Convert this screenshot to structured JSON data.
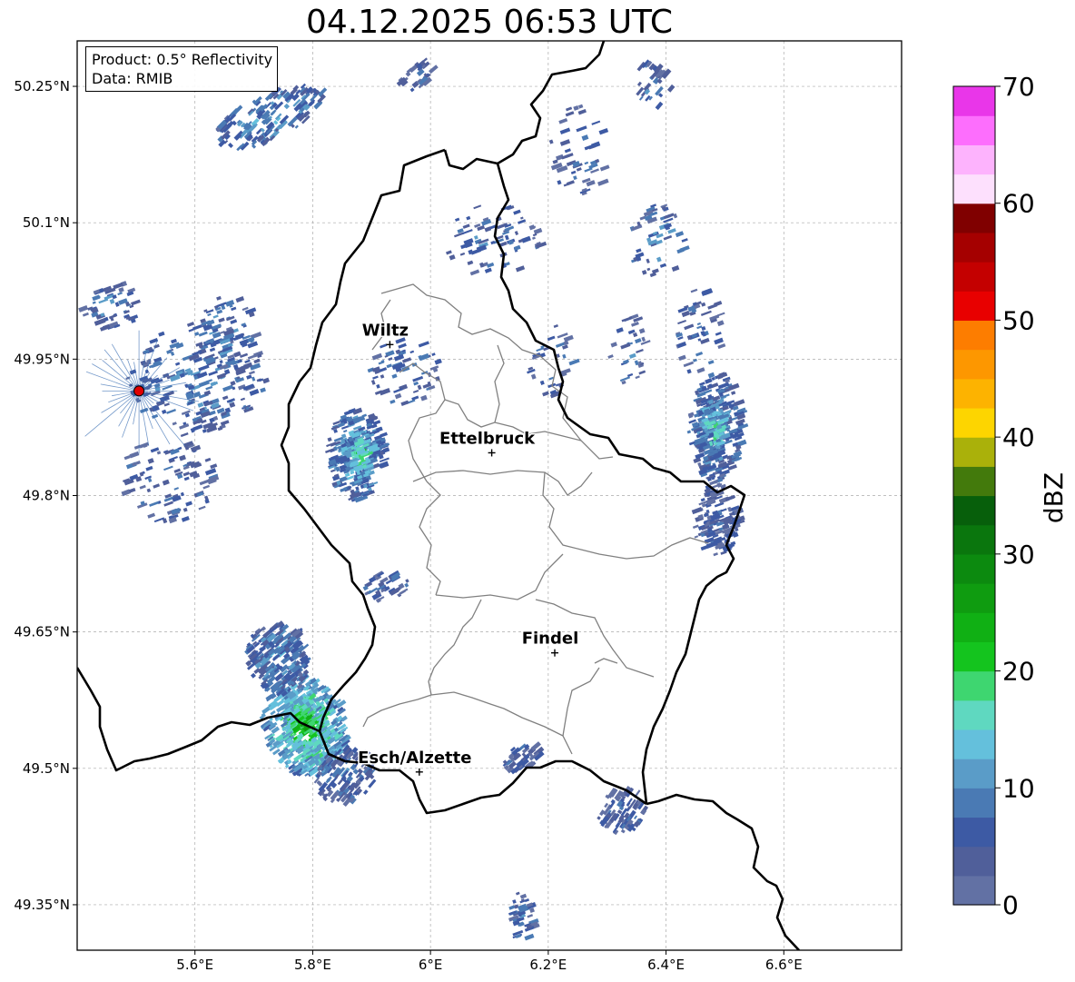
{
  "title": "04.12.2025 06:53 UTC",
  "info": {
    "product": "Product: 0.5° Reflectivity",
    "data": "Data: RMIB"
  },
  "map": {
    "lon_range": [
      5.4,
      6.8
    ],
    "lat_range": [
      49.3,
      50.3
    ],
    "lon_ticks": [
      {
        "v": 5.6,
        "label": "5.6°E"
      },
      {
        "v": 5.8,
        "label": "5.8°E"
      },
      {
        "v": 6.0,
        "label": "6°E"
      },
      {
        "v": 6.2,
        "label": "6.2°E"
      },
      {
        "v": 6.4,
        "label": "6.4°E"
      },
      {
        "v": 6.6,
        "label": "6.6°E"
      }
    ],
    "lat_ticks": [
      {
        "v": 50.25,
        "label": "50.25°N"
      },
      {
        "v": 50.1,
        "label": "50.1°N"
      },
      {
        "v": 49.95,
        "label": "49.95°N"
      },
      {
        "v": 49.8,
        "label": "49.8°N"
      },
      {
        "v": 49.65,
        "label": "49.65°N"
      },
      {
        "v": 49.5,
        "label": "49.5°N"
      },
      {
        "v": 49.35,
        "label": "49.35°N"
      }
    ],
    "cities": [
      {
        "name": "Wiltz",
        "lon": 5.931,
        "lat": 49.966
      },
      {
        "name": "Ettelbruck",
        "lon": 6.104,
        "lat": 49.847
      },
      {
        "name": "Findel",
        "lon": 6.211,
        "lat": 49.627
      },
      {
        "name": "Esch/Alzette",
        "lon": 5.981,
        "lat": 49.496
      }
    ],
    "radar_site": {
      "lon": 5.505,
      "lat": 49.915
    },
    "border_color": "#000000",
    "canton_color": "#808080"
  },
  "colorbar": {
    "label": "dBZ",
    "min": 0,
    "max": 70,
    "ticks": [
      0,
      10,
      20,
      30,
      40,
      50,
      60,
      70
    ],
    "colors": [
      "#6271a4",
      "#505f9a",
      "#3d5aa4",
      "#4a7ab4",
      "#5a9cc8",
      "#64c0dc",
      "#5fd8c0",
      "#3ed670",
      "#14c41e",
      "#10b014",
      "#0f9c10",
      "#0c8a0f",
      "#0a760d",
      "#075f0b",
      "#437a0c",
      "#aab10a",
      "#fdd500",
      "#fdb300",
      "#fd9700",
      "#fd7d00",
      "#e80000",
      "#c40000",
      "#a50000",
      "#800000",
      "#fde0fd",
      "#fdb3fd",
      "#fd6efd",
      "#e936e9"
    ]
  },
  "echoes": [
    {
      "lon": 5.78,
      "lat": 49.545,
      "rx": 0.07,
      "ry": 0.055,
      "rot": -15,
      "n": 420,
      "dbz": 18
    },
    {
      "lon": 5.78,
      "lat": 49.545,
      "rx": 0.035,
      "ry": 0.03,
      "rot": -15,
      "n": 200,
      "dbz": 22
    },
    {
      "lon": 5.735,
      "lat": 49.62,
      "rx": 0.05,
      "ry": 0.04,
      "rot": -20,
      "n": 220,
      "dbz": 9
    },
    {
      "lon": 5.85,
      "lat": 49.49,
      "rx": 0.05,
      "ry": 0.03,
      "rot": -30,
      "n": 120,
      "dbz": 7
    },
    {
      "lon": 5.87,
      "lat": 49.845,
      "rx": 0.05,
      "ry": 0.05,
      "rot": 0,
      "n": 230,
      "dbz": 11
    },
    {
      "lon": 5.875,
      "lat": 49.845,
      "rx": 0.025,
      "ry": 0.025,
      "rot": 0,
      "n": 90,
      "dbz": 17
    },
    {
      "lon": 6.48,
      "lat": 49.875,
      "rx": 0.045,
      "ry": 0.06,
      "rot": 0,
      "n": 260,
      "dbz": 9
    },
    {
      "lon": 6.475,
      "lat": 49.875,
      "rx": 0.025,
      "ry": 0.03,
      "rot": 0,
      "n": 90,
      "dbz": 15
    },
    {
      "lon": 6.48,
      "lat": 49.775,
      "rx": 0.04,
      "ry": 0.04,
      "rot": 0,
      "n": 130,
      "dbz": 5
    },
    {
      "lon": 5.72,
      "lat": 50.215,
      "rx": 0.1,
      "ry": 0.025,
      "rot": -25,
      "n": 160,
      "dbz": 10
    },
    {
      "lon": 5.6,
      "lat": 49.93,
      "rx": 0.12,
      "ry": 0.06,
      "rot": 0,
      "n": 220,
      "dbz": 8
    },
    {
      "lon": 5.55,
      "lat": 49.82,
      "rx": 0.08,
      "ry": 0.05,
      "rot": 0,
      "n": 90,
      "dbz": 6
    },
    {
      "lon": 6.32,
      "lat": 49.45,
      "rx": 0.04,
      "ry": 0.025,
      "rot": -35,
      "n": 80,
      "dbz": 6
    },
    {
      "lon": 6.15,
      "lat": 49.335,
      "rx": 0.02,
      "ry": 0.03,
      "rot": 0,
      "n": 40,
      "dbz": 8
    },
    {
      "lon": 6.15,
      "lat": 49.51,
      "rx": 0.03,
      "ry": 0.015,
      "rot": -20,
      "n": 40,
      "dbz": 6
    },
    {
      "lon": 6.1,
      "lat": 50.08,
      "rx": 0.08,
      "ry": 0.04,
      "rot": 0,
      "n": 70,
      "dbz": 7
    },
    {
      "lon": 6.25,
      "lat": 50.18,
      "rx": 0.05,
      "ry": 0.05,
      "rot": 0,
      "n": 45,
      "dbz": 6
    },
    {
      "lon": 6.38,
      "lat": 50.08,
      "rx": 0.05,
      "ry": 0.04,
      "rot": 0,
      "n": 50,
      "dbz": 8
    },
    {
      "lon": 6.45,
      "lat": 49.98,
      "rx": 0.04,
      "ry": 0.05,
      "rot": 0,
      "n": 50,
      "dbz": 6
    },
    {
      "lon": 5.95,
      "lat": 49.94,
      "rx": 0.06,
      "ry": 0.04,
      "rot": 0,
      "n": 60,
      "dbz": 7
    },
    {
      "lon": 5.92,
      "lat": 49.7,
      "rx": 0.04,
      "ry": 0.015,
      "rot": -10,
      "n": 35,
      "dbz": 6
    },
    {
      "lon": 6.2,
      "lat": 49.95,
      "rx": 0.04,
      "ry": 0.04,
      "rot": 0,
      "n": 30,
      "dbz": 7
    },
    {
      "lon": 6.33,
      "lat": 49.96,
      "rx": 0.03,
      "ry": 0.04,
      "rot": 0,
      "n": 30,
      "dbz": 7
    },
    {
      "lon": 5.97,
      "lat": 50.26,
      "rx": 0.03,
      "ry": 0.015,
      "rot": -20,
      "n": 25,
      "dbz": 6
    },
    {
      "lon": 6.37,
      "lat": 50.25,
      "rx": 0.03,
      "ry": 0.025,
      "rot": -30,
      "n": 30,
      "dbz": 8
    },
    {
      "lon": 5.45,
      "lat": 50.01,
      "rx": 0.05,
      "ry": 0.03,
      "rot": 0,
      "n": 50,
      "dbz": 8
    },
    {
      "lon": 5.65,
      "lat": 49.98,
      "rx": 0.05,
      "ry": 0.04,
      "rot": 0,
      "n": 60,
      "dbz": 9
    }
  ]
}
